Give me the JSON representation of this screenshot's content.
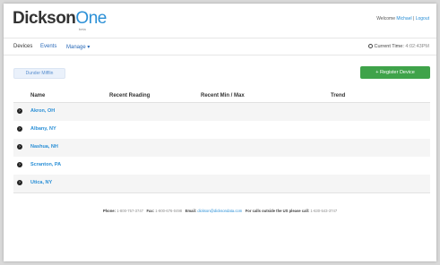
{
  "header": {
    "logo_main": "Dickson",
    "logo_accent": "One",
    "logo_sub": "beta",
    "welcome_prefix": "Welcome",
    "user_name": "Michael",
    "separator": "|",
    "logout": "Logout"
  },
  "nav": {
    "devices": "Devices",
    "events": "Events",
    "manage": "Manage",
    "time_label": "Current Time:",
    "time_value": "4:02:43PM"
  },
  "site_tab": "Dunder Mifflin",
  "register_button": "Register Device",
  "table": {
    "columns": [
      "Name",
      "Recent Reading",
      "Recent Min / Max",
      "Trend"
    ],
    "rows": [
      "Akron, OH",
      "Albany, NY",
      "Nashua, NH",
      "Scranton, PA",
      "Utica, NY"
    ]
  },
  "footer": {
    "phone_label": "Phone:",
    "phone": "1-800-757-3747",
    "fax_label": "Fax:",
    "fax": "1-800-676-0498",
    "email_label": "Email:",
    "email": "dickson@dicksondata.com",
    "intl_label": "For calls outside the US please call:",
    "intl_phone": "1-630-543-3747"
  },
  "colors": {
    "brand_blue": "#2a8fd6",
    "register_green": "#3fa34a"
  }
}
